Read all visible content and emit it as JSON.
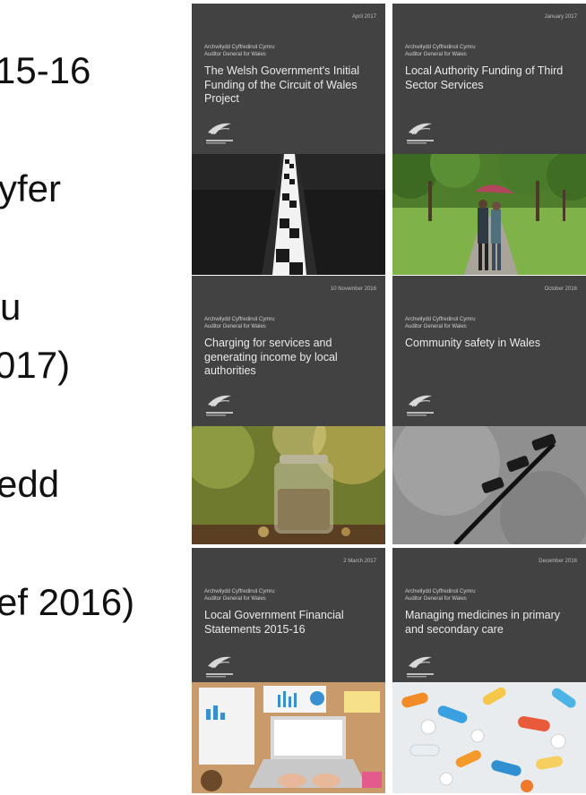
{
  "left_fragments": [
    "15-16",
    "yfer",
    "u",
    "017)",
    "edd",
    "ef 2016)"
  ],
  "org_lines": [
    "Archwilydd Cyffredinol Cymru",
    "Auditor General for Wales"
  ],
  "reports": [
    {
      "date": "April 2017",
      "title": "The Welsh Government's Initial Funding of the Circuit of Wales Project",
      "image": "race-track-image"
    },
    {
      "date": "January 2017",
      "title": "Local Authority Funding of Third Sector Services",
      "image": "park-walk-image"
    },
    {
      "date": "10 November 2016",
      "title": "Charging for services and generating income by local authorities",
      "image": "coin-jar-image"
    },
    {
      "date": "October 2016",
      "title": "Community safety in Wales",
      "image": "cctv-cameras-image"
    },
    {
      "date": "2 March 2017",
      "title": "Local Government Financial Statements 2015-16",
      "image": "laptop-desk-image"
    },
    {
      "date": "December 2016",
      "title": "Managing medicines in primary and secondary care",
      "image": "pills-image"
    }
  ]
}
